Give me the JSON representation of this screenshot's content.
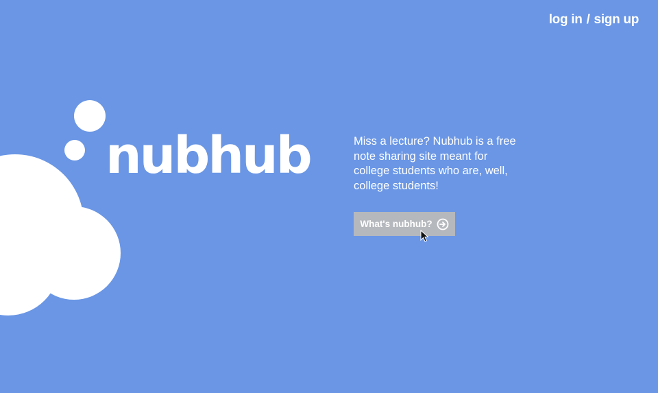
{
  "header": {
    "login": "log in",
    "separator": "/",
    "signup": "sign up"
  },
  "brand": {
    "logo_text": "nubhub"
  },
  "hero": {
    "tagline": "Miss a lecture? Nubhub is a free note sharing site meant for college students who are, well, college students!",
    "cta_label": "What's nubhub?",
    "cta_icon": "arrow-right-circle-icon"
  },
  "colors": {
    "background": "#6a96e5",
    "button": "#b5b8bd",
    "text": "#ffffff"
  }
}
